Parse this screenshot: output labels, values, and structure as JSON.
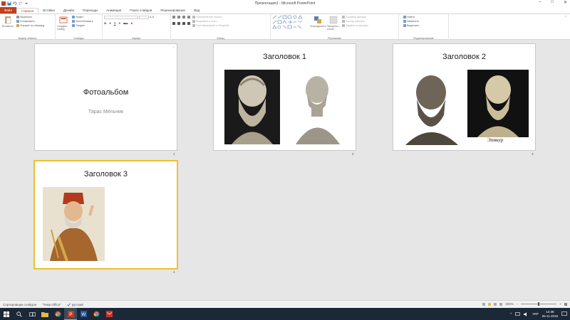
{
  "window": {
    "title": "Презентация1 - Microsoft PowerPoint",
    "minimize": "–",
    "maximize": "□",
    "close": "✕"
  },
  "tabs": [
    {
      "label": "Файл"
    },
    {
      "label": "Главная"
    },
    {
      "label": "Вставка"
    },
    {
      "label": "Дизайн"
    },
    {
      "label": "Переходы"
    },
    {
      "label": "Анимация"
    },
    {
      "label": "Показ слайдов"
    },
    {
      "label": "Рецензирование"
    },
    {
      "label": "Вид"
    }
  ],
  "ribbon": {
    "clipboard": {
      "label": "Буфер обмена",
      "paste": "Вставить",
      "cut": "Вырезать",
      "copy": "Копировать",
      "format_painter": "Формат по образцу"
    },
    "slides": {
      "label": "Слайды",
      "new_slide": "Создать слайд",
      "layout": "Макет",
      "reset": "Восстановить",
      "section": "Раздел"
    },
    "font": {
      "label": "Шрифт"
    },
    "paragraph": {
      "label": "Абзац",
      "text_direction": "Направление текста",
      "align_text": "Выровнять текст",
      "convert_smartart": "Преобразовать в SmartArt"
    },
    "drawing": {
      "label": "Рисование",
      "arrange": "Упорядочить",
      "quick_styles": "Экспресс-стили",
      "shape_fill": "Заливка фигуры",
      "shape_outline": "Контур фигуры",
      "shape_effects": "Эффекты фигуры"
    },
    "editing": {
      "label": "Редактирование",
      "find": "Найти",
      "replace": "Заменить",
      "select": "Выделить"
    }
  },
  "slides": [
    {
      "number": "1",
      "title": "Фотоальбом",
      "subtitle": "Тарас Мельник"
    },
    {
      "number": "2",
      "title": "Заголовок 1"
    },
    {
      "number": "3",
      "title": "Заголовок 2",
      "caption": "Эпикур"
    },
    {
      "number": "4",
      "title": "Заголовок 3"
    }
  ],
  "status": {
    "view": "Сортировщик слайдов",
    "theme": "\"Тема Office\"",
    "language": "русский",
    "zoom": "200%"
  },
  "taskbar": {
    "lang": "УКР",
    "time": "12:38",
    "date": "06.11.2018"
  },
  "colors": {
    "accent": "#c43e1c",
    "selection": "#f0c030",
    "taskbar": "#1b2838"
  }
}
